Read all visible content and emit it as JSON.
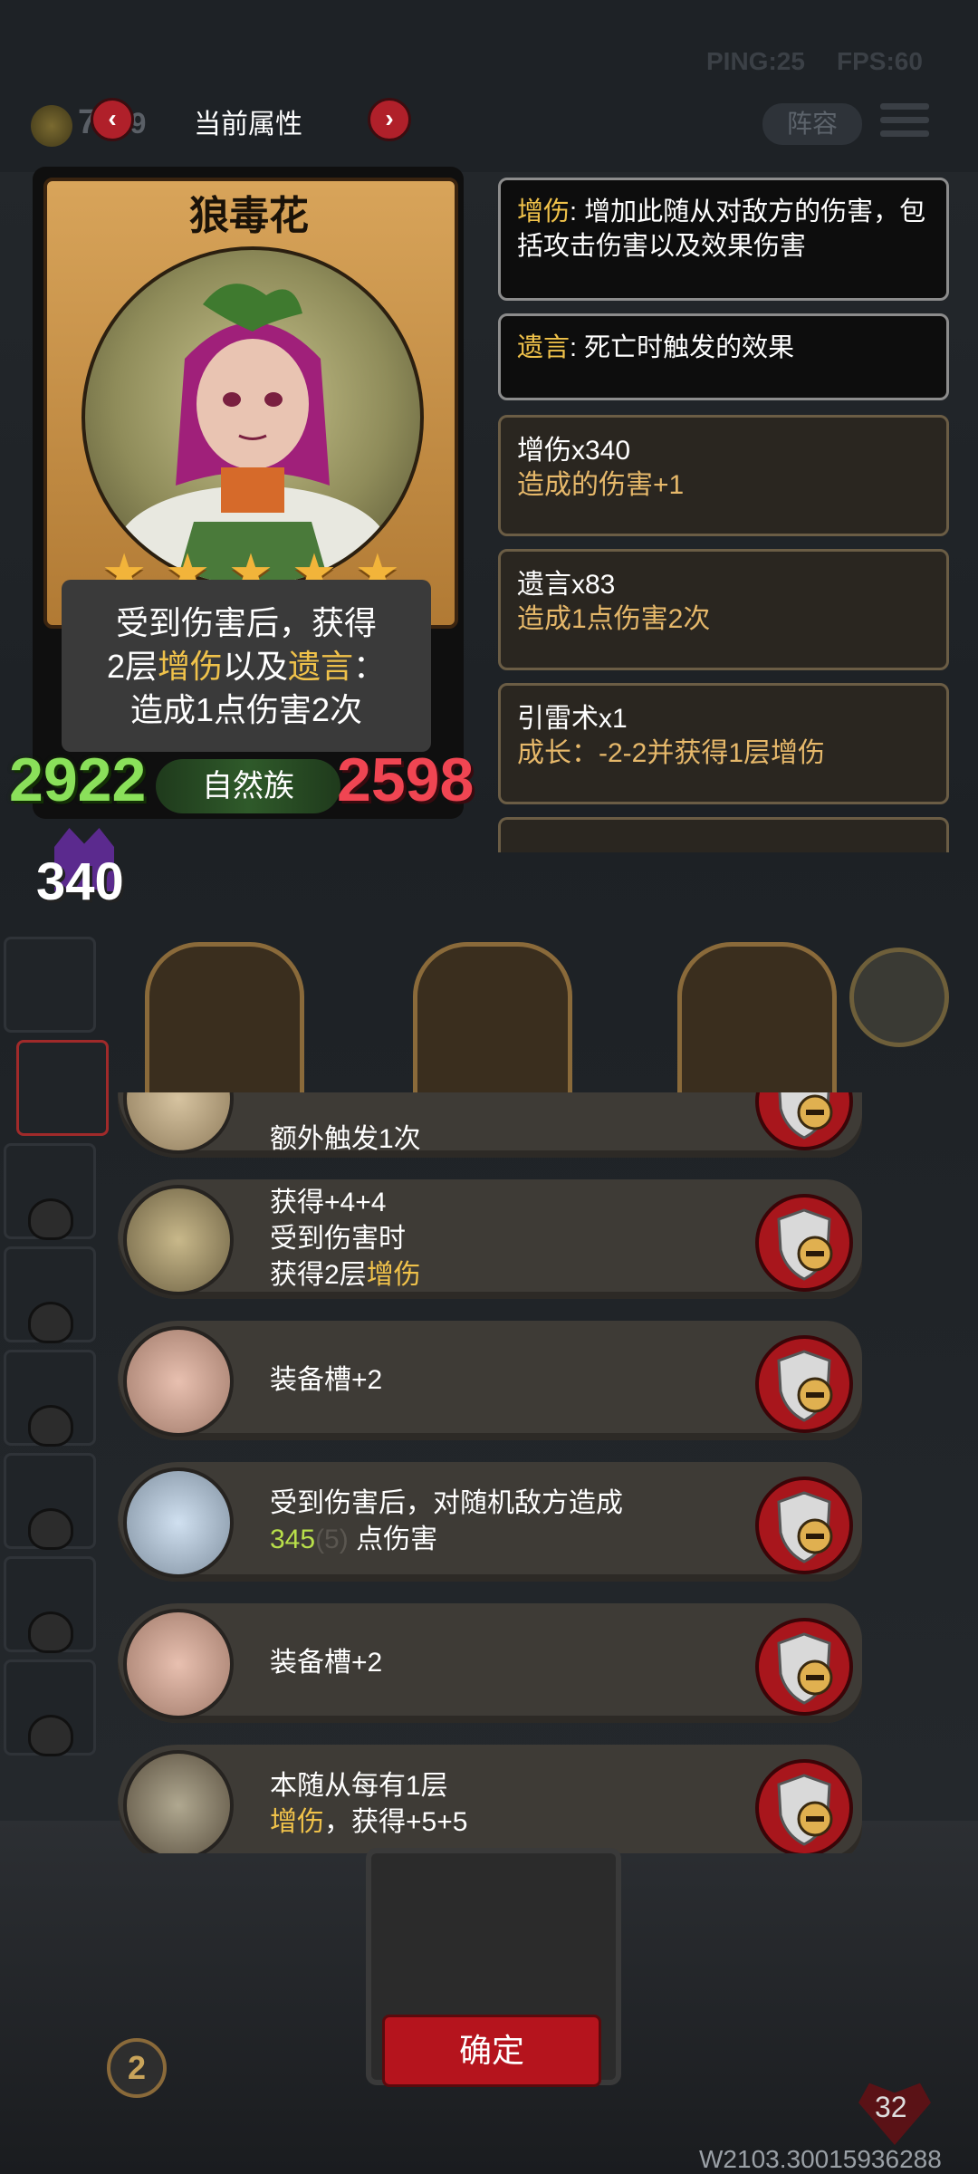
{
  "hud": {
    "ping": "PING:25",
    "fps": "FPS:60",
    "coins": "7",
    "coins_gain": "+19",
    "panel_title": "当前属性",
    "prev_arrow": "‹",
    "next_arrow": "›",
    "lineup_label": "阵容"
  },
  "card": {
    "name": "狼毒花",
    "stars": 5,
    "desc_line1": "受到伤害后，获得",
    "desc_line2_pre": "2层",
    "desc_kw1": "增伤",
    "desc_line2_mid": "以及",
    "desc_kw2": "遗言",
    "desc_line2_post": "：",
    "desc_line3": "造成1点伤害2次",
    "attack": "2922",
    "health": "2598",
    "tribe": "自然族",
    "buff_count": "340"
  },
  "info": {
    "kw1": "增伤",
    "kw1_desc": ": 增加此随从对敌方的伤害，包括攻击伤害以及效果伤害",
    "kw2": "遗言",
    "kw2_desc": ": 死亡时触发的效果"
  },
  "stats": [
    {
      "name": "增伤x340",
      "effect": "造成的伤害+1"
    },
    {
      "name": "遗言x83",
      "effect": "造成1点伤害2次"
    },
    {
      "name": "引雷术x1",
      "effect": "成长：-2-2并获得1层增伤"
    }
  ],
  "effects": {
    "row0_text": "额外触发1次",
    "row1_line1": "获得+4+4",
    "row1_line2": "受到伤害时",
    "row1_line3_pre": "获得2层",
    "row1_kw": "增伤",
    "row2_text": "装备槽+2",
    "row3_line1": "受到伤害后，对随机敌方造成",
    "row3_value": "345",
    "row3_faded": "(5)",
    "row3_post": "点伤害",
    "row4_text": "装备槽+2",
    "row5_line1": "本随从每有1层",
    "row5_kw": "增伤",
    "row5_post": "，获得+5+5"
  },
  "bottom": {
    "confirm_label": "确定",
    "count_badge": "2",
    "heart_value": "32",
    "watermark": "W2103.30015936288"
  },
  "colors": {
    "highlight": "#f0c24a",
    "attack": "#8ae05a",
    "health": "#f04552",
    "accent_red": "#b5141d"
  }
}
